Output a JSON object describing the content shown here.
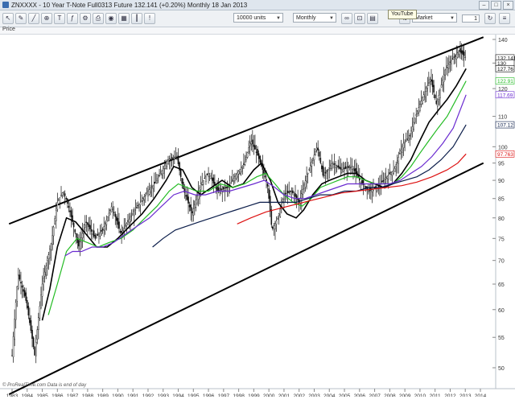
{
  "window": {
    "title": "ZNXXXX - 10 Year T-Note Full0313 Future   132.141  (+0.20%)   Monthly  18 Jan 2013"
  },
  "toolbar": {
    "units_select": "10000 units",
    "period_select": "Monthly",
    "order_type_select": "Market",
    "quantity": "1",
    "tooltip": "YouTube"
  },
  "subbar": {
    "label": "Price"
  },
  "footer": "© ProRealTime.com  Data is end of day",
  "colors": {
    "candle": "#111111",
    "channel": "#000000",
    "ma_black": "#000000",
    "ma_green": "#22bb22",
    "ma_purple": "#6a2bd0",
    "ma_navy": "#0b1d4a",
    "ma_red": "#dd1111"
  },
  "chart_data": {
    "type": "candlestick",
    "title": "ZNXXXX - 10 Year T-Note Full0313 Future",
    "x_ticks": [
      "1983",
      "1984",
      "1985",
      "1986",
      "1987",
      "1988",
      "1989",
      "1990",
      "1991",
      "1992",
      "1993",
      "1994",
      "1995",
      "1996",
      "1997",
      "1998",
      "1999",
      "2000",
      "2001",
      "2002",
      "2003",
      "2004",
      "2005",
      "2006",
      "2007",
      "2008",
      "2009",
      "2010",
      "2011",
      "2012",
      "2013",
      "2014"
    ],
    "y_ticks": [
      50,
      55,
      60,
      65,
      70,
      75,
      80,
      85,
      90,
      95,
      100,
      110,
      120,
      130,
      140
    ],
    "price_labels": [
      {
        "text": "132.141",
        "color": "#111111",
        "value": 132.14
      },
      {
        "text": "130",
        "color": "#111111",
        "value": 130
      },
      {
        "text": "127.76",
        "color": "#000000",
        "value": 127.76
      },
      {
        "text": "122.91",
        "color": "#22bb22",
        "value": 122.91
      },
      {
        "text": "117.69",
        "color": "#6a2bd0",
        "value": 117.69
      },
      {
        "text": "107.12",
        "color": "#0b1d4a",
        "value": 107.12
      },
      {
        "text": "97.763",
        "color": "#dd1111",
        "value": 97.76
      }
    ],
    "price_anchors": [
      [
        1983.0,
        52
      ],
      [
        1983.4,
        67
      ],
      [
        1983.9,
        62
      ],
      [
        1984.5,
        52
      ],
      [
        1985.0,
        65
      ],
      [
        1985.6,
        74
      ],
      [
        1986.0,
        84
      ],
      [
        1986.4,
        87
      ],
      [
        1986.8,
        82
      ],
      [
        1987.4,
        73
      ],
      [
        1987.9,
        79
      ],
      [
        1988.5,
        75
      ],
      [
        1989.0,
        77
      ],
      [
        1989.6,
        83
      ],
      [
        1990.2,
        76
      ],
      [
        1990.8,
        80
      ],
      [
        1991.5,
        84
      ],
      [
        1992.0,
        87
      ],
      [
        1992.6,
        90
      ],
      [
        1993.3,
        96
      ],
      [
        1993.9,
        97
      ],
      [
        1994.3,
        88
      ],
      [
        1994.9,
        81
      ],
      [
        1995.5,
        89
      ],
      [
        1996.0,
        92
      ],
      [
        1996.6,
        87
      ],
      [
        1997.3,
        88
      ],
      [
        1997.9,
        92
      ],
      [
        1998.4,
        95
      ],
      [
        1998.8,
        102
      ],
      [
        1999.2,
        98
      ],
      [
        1999.9,
        89
      ],
      [
        2000.2,
        77
      ],
      [
        2000.6,
        80
      ],
      [
        2001.0,
        86
      ],
      [
        2001.5,
        87
      ],
      [
        2002.0,
        84
      ],
      [
        2002.5,
        91
      ],
      [
        2003.2,
        100
      ],
      [
        2003.6,
        91
      ],
      [
        2004.2,
        95
      ],
      [
        2004.8,
        93
      ],
      [
        2005.5,
        94
      ],
      [
        2006.0,
        90
      ],
      [
        2006.6,
        87
      ],
      [
        2007.2,
        88
      ],
      [
        2007.8,
        91
      ],
      [
        2008.3,
        93
      ],
      [
        2008.9,
        101
      ],
      [
        2009.3,
        103
      ],
      [
        2009.7,
        110
      ],
      [
        2010.2,
        117
      ],
      [
        2010.7,
        124
      ],
      [
        2011.1,
        114
      ],
      [
        2011.7,
        128
      ],
      [
        2012.2,
        132
      ],
      [
        2012.6,
        135
      ],
      [
        2013.05,
        132.14
      ]
    ],
    "channel_upper": [
      [
        1982.8,
        78.5
      ],
      [
        2014.2,
        141
      ]
    ],
    "channel_lower": [
      [
        1982.8,
        46
      ],
      [
        2014.2,
        95
      ]
    ],
    "moving_averages": [
      {
        "color": "#000000",
        "last": 127.76,
        "points": [
          [
            1985.0,
            58
          ],
          [
            1985.5,
            64
          ],
          [
            1986.0,
            73
          ],
          [
            1986.6,
            80
          ],
          [
            1987.2,
            79
          ],
          [
            1987.9,
            76
          ],
          [
            1988.6,
            73
          ],
          [
            1989.3,
            73
          ],
          [
            1990.0,
            75
          ],
          [
            1990.8,
            78
          ],
          [
            1991.6,
            81
          ],
          [
            1992.4,
            85
          ],
          [
            1993.2,
            90
          ],
          [
            1993.7,
            94
          ],
          [
            1994.3,
            93
          ],
          [
            1994.9,
            88
          ],
          [
            1995.5,
            86
          ],
          [
            1996.2,
            88
          ],
          [
            1996.9,
            90
          ],
          [
            1997.6,
            88
          ],
          [
            1998.3,
            89
          ],
          [
            1999.0,
            93
          ],
          [
            1999.5,
            95
          ],
          [
            2000.1,
            90
          ],
          [
            2000.6,
            84
          ],
          [
            2001.2,
            81
          ],
          [
            2001.8,
            80
          ],
          [
            2002.3,
            82
          ],
          [
            2002.9,
            86
          ],
          [
            2003.5,
            89
          ],
          [
            2004.0,
            90
          ],
          [
            2004.6,
            91
          ],
          [
            2005.2,
            92
          ],
          [
            2005.8,
            92
          ],
          [
            2006.4,
            90
          ],
          [
            2007.0,
            89
          ],
          [
            2007.6,
            88
          ],
          [
            2008.2,
            89
          ],
          [
            2008.8,
            92
          ],
          [
            2009.4,
            96
          ],
          [
            2010.0,
            102
          ],
          [
            2010.6,
            108
          ],
          [
            2011.2,
            112
          ],
          [
            2011.8,
            116
          ],
          [
            2012.4,
            121
          ],
          [
            2013.05,
            127.76
          ]
        ]
      },
      {
        "color": "#22bb22",
        "last": 122.91,
        "points": [
          [
            1985.4,
            59
          ],
          [
            1986.0,
            65
          ],
          [
            1986.6,
            72
          ],
          [
            1987.3,
            75
          ],
          [
            1988.0,
            74
          ],
          [
            1988.7,
            73
          ],
          [
            1989.4,
            74
          ],
          [
            1990.2,
            75
          ],
          [
            1991.0,
            77
          ],
          [
            1991.8,
            80
          ],
          [
            1992.6,
            83
          ],
          [
            1993.4,
            87
          ],
          [
            1994.0,
            89
          ],
          [
            1994.6,
            88
          ],
          [
            1995.2,
            87
          ],
          [
            1996.0,
            87
          ],
          [
            1996.8,
            89
          ],
          [
            1997.6,
            88
          ],
          [
            1998.4,
            89
          ],
          [
            1999.2,
            91
          ],
          [
            1999.8,
            92
          ],
          [
            2000.4,
            89
          ],
          [
            2001.0,
            86
          ],
          [
            2001.6,
            84
          ],
          [
            2002.2,
            83
          ],
          [
            2002.8,
            85
          ],
          [
            2003.4,
            88
          ],
          [
            2004.0,
            89
          ],
          [
            2004.6,
            90
          ],
          [
            2005.2,
            91
          ],
          [
            2005.8,
            91
          ],
          [
            2006.4,
            90
          ],
          [
            2007.0,
            89
          ],
          [
            2007.6,
            89
          ],
          [
            2008.2,
            89
          ],
          [
            2008.8,
            91
          ],
          [
            2009.4,
            94
          ],
          [
            2010.0,
            98
          ],
          [
            2010.6,
            102
          ],
          [
            2011.2,
            106
          ],
          [
            2011.8,
            110
          ],
          [
            2012.4,
            116
          ],
          [
            2013.05,
            122.91
          ]
        ]
      },
      {
        "color": "#6a2bd0",
        "last": 117.69,
        "points": [
          [
            1986.5,
            71
          ],
          [
            1987.0,
            72
          ],
          [
            1987.6,
            72
          ],
          [
            1988.3,
            73
          ],
          [
            1989.0,
            73
          ],
          [
            1989.7,
            74
          ],
          [
            1990.5,
            76
          ],
          [
            1991.3,
            78
          ],
          [
            1992.1,
            80
          ],
          [
            1992.9,
            83
          ],
          [
            1993.7,
            86
          ],
          [
            1994.4,
            87
          ],
          [
            1995.1,
            86
          ],
          [
            1995.8,
            86
          ],
          [
            1996.6,
            87
          ],
          [
            1997.4,
            87
          ],
          [
            1998.2,
            88
          ],
          [
            1999.0,
            89
          ],
          [
            1999.7,
            90
          ],
          [
            2000.4,
            88
          ],
          [
            2001.0,
            86
          ],
          [
            2001.7,
            85
          ],
          [
            2002.4,
            85
          ],
          [
            2003.1,
            86
          ],
          [
            2003.8,
            87
          ],
          [
            2004.5,
            88
          ],
          [
            2005.2,
            89
          ],
          [
            2005.9,
            89
          ],
          [
            2006.6,
            89
          ],
          [
            2007.3,
            89
          ],
          [
            2008.0,
            89
          ],
          [
            2008.7,
            90
          ],
          [
            2009.4,
            92
          ],
          [
            2010.1,
            94
          ],
          [
            2010.8,
            97
          ],
          [
            2011.5,
            101
          ],
          [
            2012.2,
            106
          ],
          [
            2013.05,
            117.69
          ]
        ]
      },
      {
        "color": "#0b1d4a",
        "last": 107.12,
        "points": [
          [
            1992.3,
            73
          ],
          [
            1993.0,
            75
          ],
          [
            1993.8,
            77
          ],
          [
            1994.6,
            78
          ],
          [
            1995.4,
            79
          ],
          [
            1996.2,
            80
          ],
          [
            1997.0,
            81
          ],
          [
            1997.8,
            82
          ],
          [
            1998.6,
            83
          ],
          [
            1999.4,
            84
          ],
          [
            2000.2,
            84
          ],
          [
            2001.0,
            84
          ],
          [
            2001.8,
            84
          ],
          [
            2002.6,
            85
          ],
          [
            2003.4,
            86
          ],
          [
            2004.2,
            86
          ],
          [
            2005.0,
            87
          ],
          [
            2005.8,
            87
          ],
          [
            2006.6,
            88
          ],
          [
            2007.4,
            88
          ],
          [
            2008.2,
            89
          ],
          [
            2009.0,
            90
          ],
          [
            2009.8,
            91
          ],
          [
            2010.6,
            93
          ],
          [
            2011.4,
            96
          ],
          [
            2012.2,
            100
          ],
          [
            2013.05,
            107.12
          ]
        ]
      },
      {
        "color": "#dd1111",
        "last": 97.76,
        "points": [
          [
            1997.9,
            78.5
          ],
          [
            1998.8,
            80
          ],
          [
            1999.8,
            81.5
          ],
          [
            2000.8,
            82.5
          ],
          [
            2001.8,
            83.5
          ],
          [
            2002.8,
            84.5
          ],
          [
            2003.8,
            85.5
          ],
          [
            2004.8,
            86.5
          ],
          [
            2005.8,
            87
          ],
          [
            2006.8,
            87.5
          ],
          [
            2007.8,
            88
          ],
          [
            2008.8,
            88.5
          ],
          [
            2009.8,
            89.5
          ],
          [
            2010.8,
            91
          ],
          [
            2011.8,
            93
          ],
          [
            2012.5,
            95
          ],
          [
            2013.05,
            97.76
          ]
        ]
      }
    ]
  }
}
